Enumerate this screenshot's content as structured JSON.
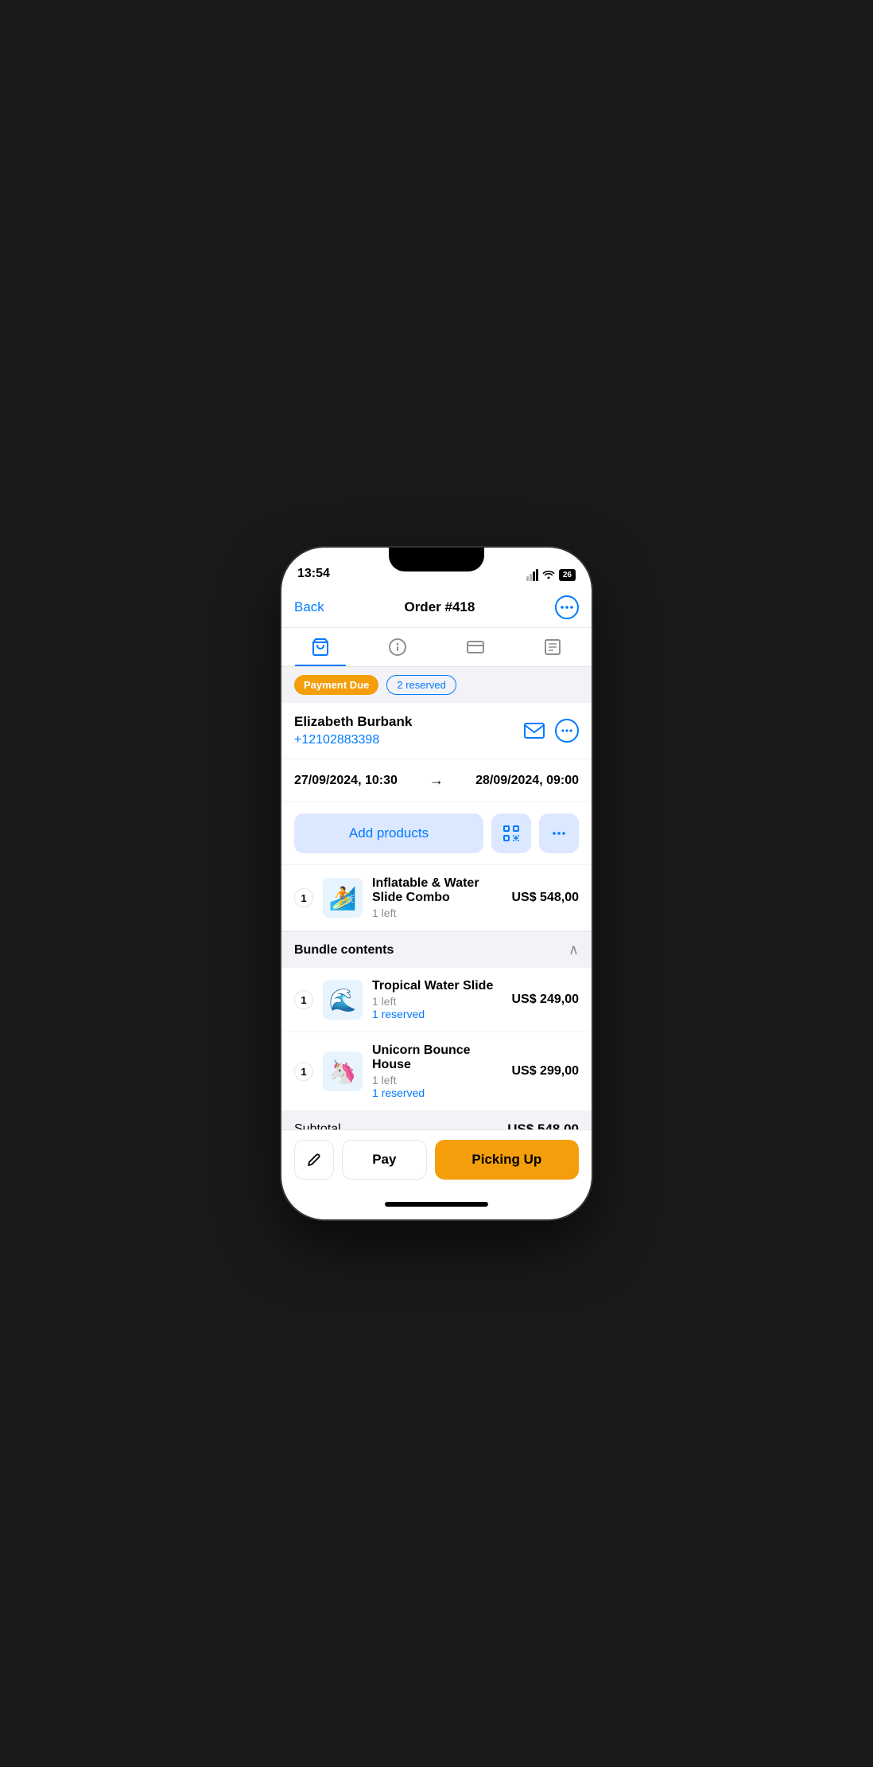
{
  "statusBar": {
    "time": "13:54",
    "battery": "26"
  },
  "header": {
    "back_label": "Back",
    "title": "Order #418",
    "more_label": "..."
  },
  "tabs": [
    {
      "id": "cart",
      "icon": "cart",
      "active": true
    },
    {
      "id": "info",
      "icon": "info",
      "active": false
    },
    {
      "id": "card",
      "icon": "card",
      "active": false
    },
    {
      "id": "list",
      "icon": "list",
      "active": false
    }
  ],
  "statusBadges": {
    "payment": "Payment Due",
    "reserved": "2 reserved"
  },
  "customer": {
    "name": "Elizabeth Burbank",
    "phone": "+12102883398"
  },
  "dates": {
    "start": "27/09/2024, 10:30",
    "end": "28/09/2024, 09:00",
    "arrow": "→"
  },
  "actions": {
    "add_products": "Add products",
    "scan_icon": "⊡",
    "more_icon": "..."
  },
  "products": [
    {
      "qty": "1",
      "name": "Inflatable & Water Slide Combo",
      "availability": "1 left",
      "price": "US$ 548,00",
      "reserved": null,
      "emoji": "🏄"
    }
  ],
  "bundle": {
    "title": "Bundle contents",
    "chevron": "∧",
    "items": [
      {
        "qty": "1",
        "name": "Tropical Water Slide",
        "availability": "1 left",
        "reserved": "1 reserved",
        "price": "US$ 249,00",
        "emoji": "🌊"
      },
      {
        "qty": "1",
        "name": "Unicorn Bounce House",
        "availability": "1 left",
        "reserved": "1 reserved",
        "price": "US$ 299,00",
        "emoji": "🦄"
      }
    ]
  },
  "subtotal": {
    "label": "Subtotal",
    "amount": "US$ 548,00"
  },
  "bottomBar": {
    "edit_icon": "✏",
    "pay_label": "Pay",
    "pickup_label": "Picking Up"
  },
  "colors": {
    "blue": "#007aff",
    "amber": "#f59e0b",
    "light_blue_bg": "#dce8ff",
    "gray_bg": "#f2f2f7"
  }
}
